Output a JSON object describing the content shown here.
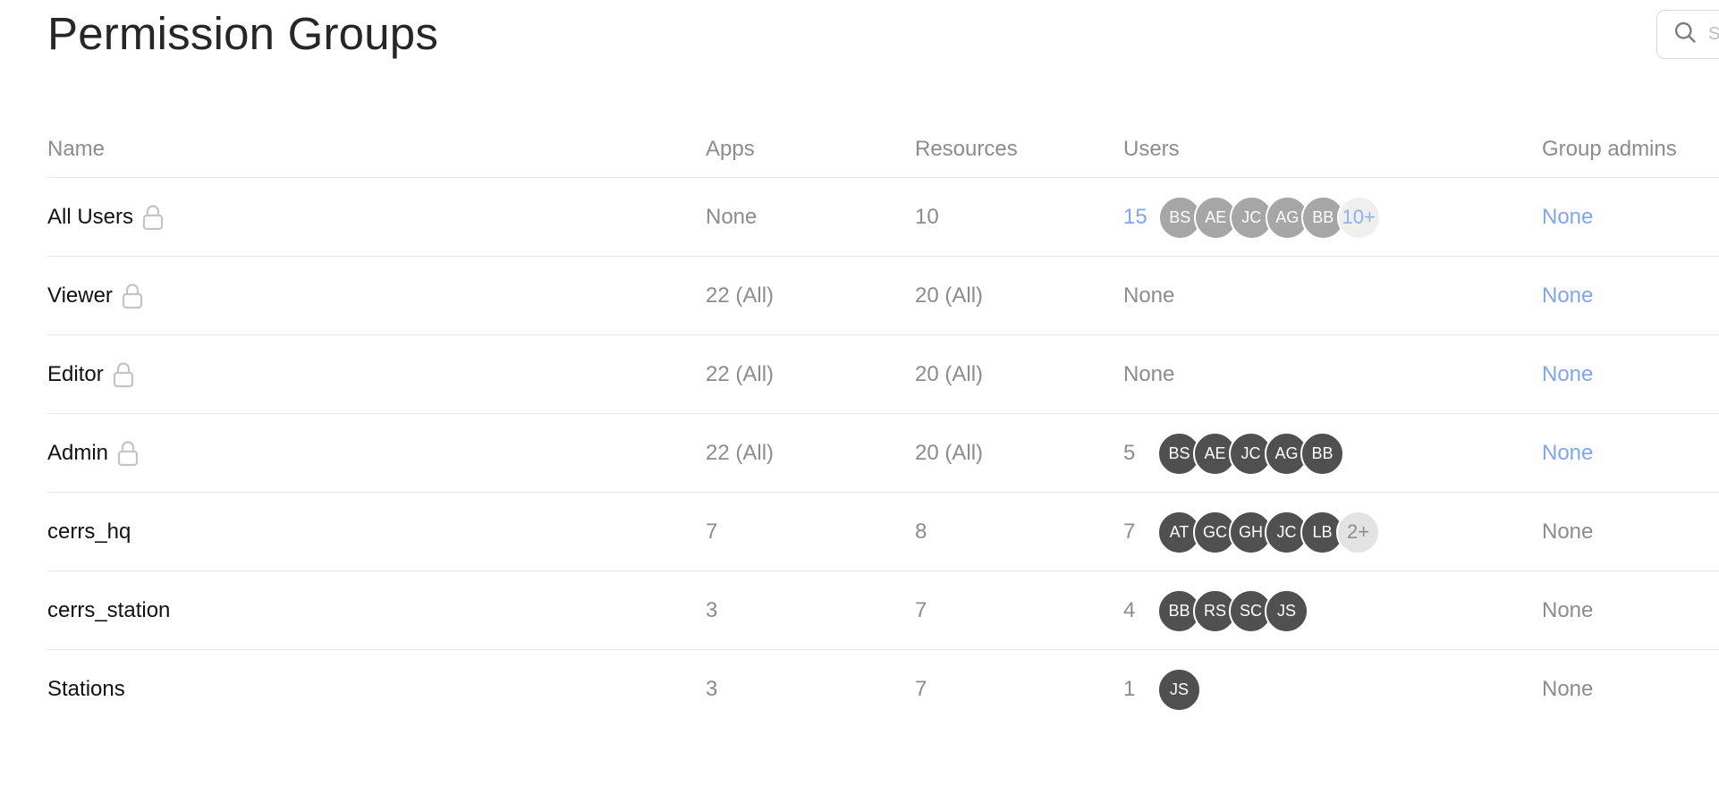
{
  "page": {
    "title": "Permission Groups"
  },
  "search": {
    "placeholder": "Search"
  },
  "table": {
    "headers": {
      "name": "Name",
      "apps": "Apps",
      "resources": "Resources",
      "users": "Users",
      "group_admins": "Group admins"
    },
    "rows": [
      {
        "name": "All Users",
        "locked": true,
        "apps": "None",
        "resources": "10",
        "users_count": "15",
        "avatars": [
          "BS",
          "AE",
          "JC",
          "AG",
          "BB"
        ],
        "more": "10+",
        "admins": "None"
      },
      {
        "name": "Viewer",
        "locked": true,
        "apps": "22 (All)",
        "resources": "20 (All)",
        "users_none": "None",
        "admins": "None"
      },
      {
        "name": "Editor",
        "locked": true,
        "apps": "22 (All)",
        "resources": "20 (All)",
        "users_none": "None",
        "admins": "None"
      },
      {
        "name": "Admin",
        "locked": true,
        "apps": "22 (All)",
        "resources": "20 (All)",
        "users_count": "5",
        "avatars": [
          "BS",
          "AE",
          "JC",
          "AG",
          "BB"
        ],
        "admins": "None"
      },
      {
        "name": "cerrs_hq",
        "locked": false,
        "apps": "7",
        "resources": "8",
        "users_count": "7",
        "avatars": [
          "AT",
          "GC",
          "GH",
          "JC",
          "LB"
        ],
        "more": "2+",
        "admins": "None"
      },
      {
        "name": "cerrs_station",
        "locked": false,
        "apps": "3",
        "resources": "7",
        "users_count": "4",
        "avatars": [
          "BB",
          "RS",
          "SC",
          "JS"
        ],
        "admins": "None"
      },
      {
        "name": "Stations",
        "locked": false,
        "apps": "3",
        "resources": "7",
        "users_count": "1",
        "avatars": [
          "JS"
        ],
        "admins": "None"
      }
    ]
  },
  "colors": {
    "link": "#7ea7ee",
    "muted_text": "#8c8c8c",
    "avatar_dark": "#505050",
    "avatar_light": "#a6a6a6",
    "divider": "#e6e6e6"
  },
  "icons": {
    "search": "search-icon",
    "lock": "lock-icon"
  }
}
